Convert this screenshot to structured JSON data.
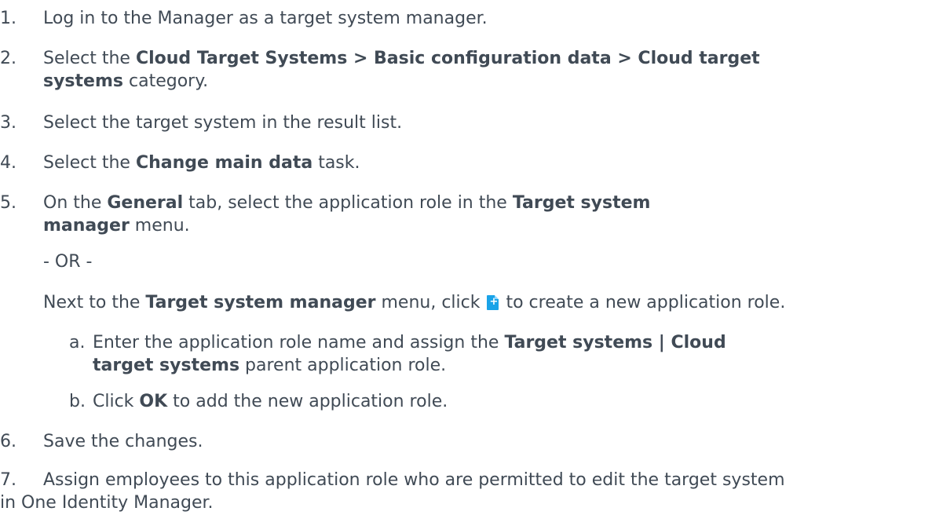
{
  "steps": [
    {
      "num": "1.",
      "text": "Log in to the Manager as a target system manager."
    },
    {
      "num": "2.",
      "line1_pre": "Select the ",
      "line1_bold": "Cloud Target Systems > Basic configuration data > Cloud target",
      "line2_bold": "systems",
      "line2_post": " category."
    },
    {
      "num": "3.",
      "text": "Select the target system in the result list."
    },
    {
      "num": "4.",
      "pre": "Select the ",
      "bold": "Change main data",
      "post": " task."
    },
    {
      "num": "5.",
      "line1_pre": "On the ",
      "line1_bold1": "General",
      "line1_mid": " tab, select the application role in the ",
      "line1_bold2": "Target system",
      "line2_bold": "manager",
      "line2_post": " menu.",
      "or_text": "- OR -",
      "next_pre": "Next to the ",
      "next_bold": "Target system manager",
      "next_mid": " menu, click ",
      "next_icon": "new-application-role-icon",
      "next_post": " to create a new application role.",
      "substeps": [
        {
          "num": "a.",
          "line1_pre": "Enter the application role name and assign the ",
          "line1_bold": "Target systems | Cloud",
          "line2_bold": "target systems",
          "line2_post": " parent application role."
        },
        {
          "num": "b.",
          "pre": "Click ",
          "bold": "OK",
          "post": " to add the new application role."
        }
      ]
    },
    {
      "num": "6.",
      "text": "Save the changes."
    },
    {
      "num": "7.",
      "line1": "Assign employees to this application role who are permitted to edit the target system",
      "line2": "in One Identity Manager."
    }
  ],
  "colors": {
    "text": "#404a55",
    "icon": "#1aa3e8"
  }
}
